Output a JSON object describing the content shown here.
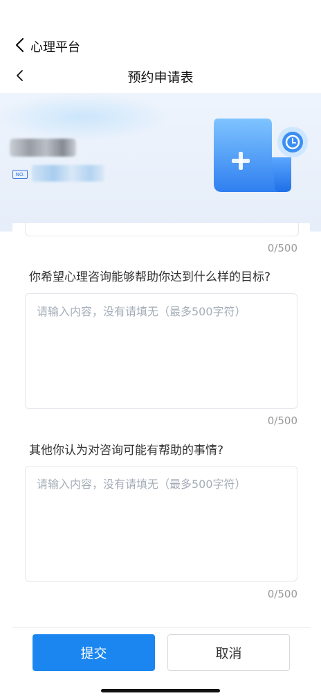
{
  "app": {
    "name": "心理平台"
  },
  "page": {
    "title": "预约申请表"
  },
  "banner": {
    "no_label": "NO."
  },
  "form": {
    "prev_counter": "0/500",
    "fields": [
      {
        "question": "你希望心理咨询能够帮助你达到什么样的目标?",
        "placeholder": "请输入内容，没有请填无（最多500字符）",
        "counter": "0/500"
      },
      {
        "question": "其他你认为对咨询可能有帮助的事情?",
        "placeholder": "请输入内容，没有请填无（最多500字符）",
        "counter": "0/500"
      }
    ]
  },
  "actions": {
    "submit": "提交",
    "cancel": "取消"
  },
  "colors": {
    "accent": "#1b86f0",
    "placeholder": "#a4adb8"
  }
}
